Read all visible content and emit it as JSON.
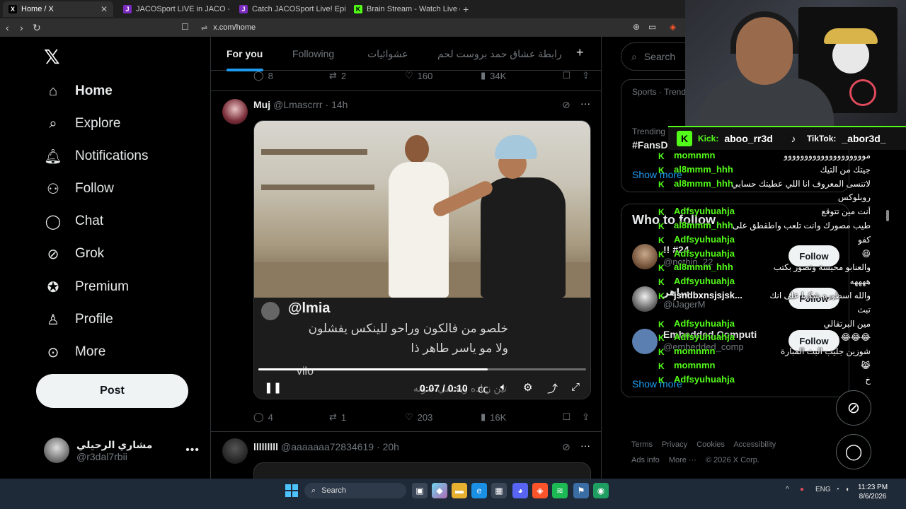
{
  "browser": {
    "tabs": [
      {
        "title": "Home / X",
        "icon": "x-icon",
        "active": true
      },
      {
        "title": "JACOSport LIVE in JACO - JACO",
        "icon": "jaco-icon",
        "active": false
      },
      {
        "title": "Catch JACOSport Live! Epic Sports Fu",
        "icon": "jaco-icon",
        "active": false
      },
      {
        "title": "Brain Stream - Watch Live on Kick",
        "icon": "kick-icon",
        "active": false
      }
    ],
    "new_tab": "+",
    "url": "x.com/home"
  },
  "nav": {
    "items": [
      {
        "label": "Home",
        "icon": "home-icon"
      },
      {
        "label": "Explore",
        "icon": "search-icon"
      },
      {
        "label": "Notifications",
        "icon": "bell-icon"
      },
      {
        "label": "Follow",
        "icon": "follow-icon"
      },
      {
        "label": "Chat",
        "icon": "chat-icon"
      },
      {
        "label": "Grok",
        "icon": "grok-icon"
      },
      {
        "label": "Premium",
        "icon": "premium-icon"
      },
      {
        "label": "Profile",
        "icon": "profile-icon"
      },
      {
        "label": "More",
        "icon": "more-icon"
      }
    ],
    "post_label": "Post",
    "account": {
      "name": "مشاري الرحيلي",
      "handle": "@r3dal7rbii"
    }
  },
  "feed": {
    "tabs": [
      "For you",
      "Following",
      "عشوائيات",
      "رابطة عشاق حمد بروست لحم"
    ],
    "prev_post_actions": {
      "replies": "8",
      "reposts": "2",
      "likes": "160",
      "views": "34K"
    },
    "post": {
      "name": "Muj",
      "handle": "@Lmascrrr",
      "time": "· 14h",
      "caption_user": "@lmia",
      "caption_line1": "خلصو من فالكون وراحو للينكس يفشلون",
      "caption_line2": "ولا مو ياسر طاهر ذا",
      "caption_user2": "vilo",
      "caption_ghost": "تين زياده ويختفي صوته",
      "video_time": "0:07 / 0:10",
      "progress": 0.7,
      "actions": {
        "replies": "4",
        "reposts": "1",
        "likes": "203",
        "views": "16K"
      }
    },
    "next_post": {
      "name": "lllllllll",
      "handle": "@aaaaaaa72834619",
      "time": "· 20h"
    }
  },
  "right": {
    "search_placeholder": "Search",
    "trends": {
      "meta": "Sports · Trend",
      "label": "Trending",
      "tag": "#FansD",
      "show_more": "Show more"
    },
    "who_to_follow": {
      "title": "Who to follow",
      "users": [
        {
          "name": "!! #24",
          "handle": "@nothin_22",
          "button": "Follow"
        },
        {
          "name": "ساهر",
          "handle": "@iJagerM",
          "button": "Follow"
        },
        {
          "name": "Embedded Computi",
          "handle": "@embedded_comp",
          "button": "Follow"
        }
      ],
      "show_more": "Show more"
    },
    "footer": [
      "Terms",
      "Privacy",
      "Cookies",
      "Accessibility",
      "Ads info",
      "More ···",
      "© 2026 X Corp."
    ]
  },
  "overlay": {
    "kick_label": "Kick:",
    "kick_user": "aboo_rr3d",
    "tiktok_label": "TikTok:",
    "tiktok_user": "_abor3d_",
    "chat": [
      {
        "user": "momnmn",
        "msg": "موووووووووووووووووووو",
        "color": "#53fc18"
      },
      {
        "user": "al8mmm_hhh",
        "msg": "جيتك من التيك",
        "color": "#53fc18"
      },
      {
        "user": "al8mmm_hhh",
        "msg": "لاتنسى المعروف انا اللي عطيتك حسابي",
        "color": "#53fc18"
      },
      {
        "user": "",
        "msg": "روبلوكس",
        "color": "#53fc18"
      },
      {
        "user": "Adfsyuhuahja",
        "msg": "أنت مين تتوقع",
        "color": "#53fc18"
      },
      {
        "user": "al8mmm_hhh",
        "msg": "طيب مصورك وانت تلعب واطقطق على سكني",
        "color": "#53fc18"
      },
      {
        "user": "Adfsyuhuahja",
        "msg": "كفو",
        "color": "#53fc18"
      },
      {
        "user": "Adfsyuhuahja",
        "msg": "😆",
        "color": "#53fc18"
      },
      {
        "user": "al8mmm_hhh",
        "msg": "والعنابو محيسة وتصور بكتب",
        "color": "#53fc18"
      },
      {
        "user": "Adfsyuhuahja",
        "msg": "ههههه",
        "color": "#53fc18"
      },
      {
        "user": "jsndbxnsjsjsk...",
        "msg": "والله اسطوره شكرا على انك",
        "color": "#ffffff"
      },
      {
        "user": "",
        "msg": "تبث",
        "color": "#53fc18"
      },
      {
        "user": "Adfsyuhuahja",
        "msg": "مين البرتقالي",
        "color": "#53fc18"
      },
      {
        "user": "Adfsyuhuahja",
        "msg": "😂😂😂",
        "color": "#53fc18"
      },
      {
        "user": "momnmn",
        "msg": "شوزين جليب البث المبارة",
        "color": "#53fc18"
      },
      {
        "user": "momnmn",
        "msg": "😹",
        "color": "#53fc18"
      },
      {
        "user": "Adfsyuhuahja",
        "msg": "خ",
        "color": "#53fc18"
      }
    ]
  },
  "taskbar": {
    "search_label": "Search",
    "lang": "ENG",
    "time": "11:23 PM",
    "date": "8/6/2026"
  }
}
